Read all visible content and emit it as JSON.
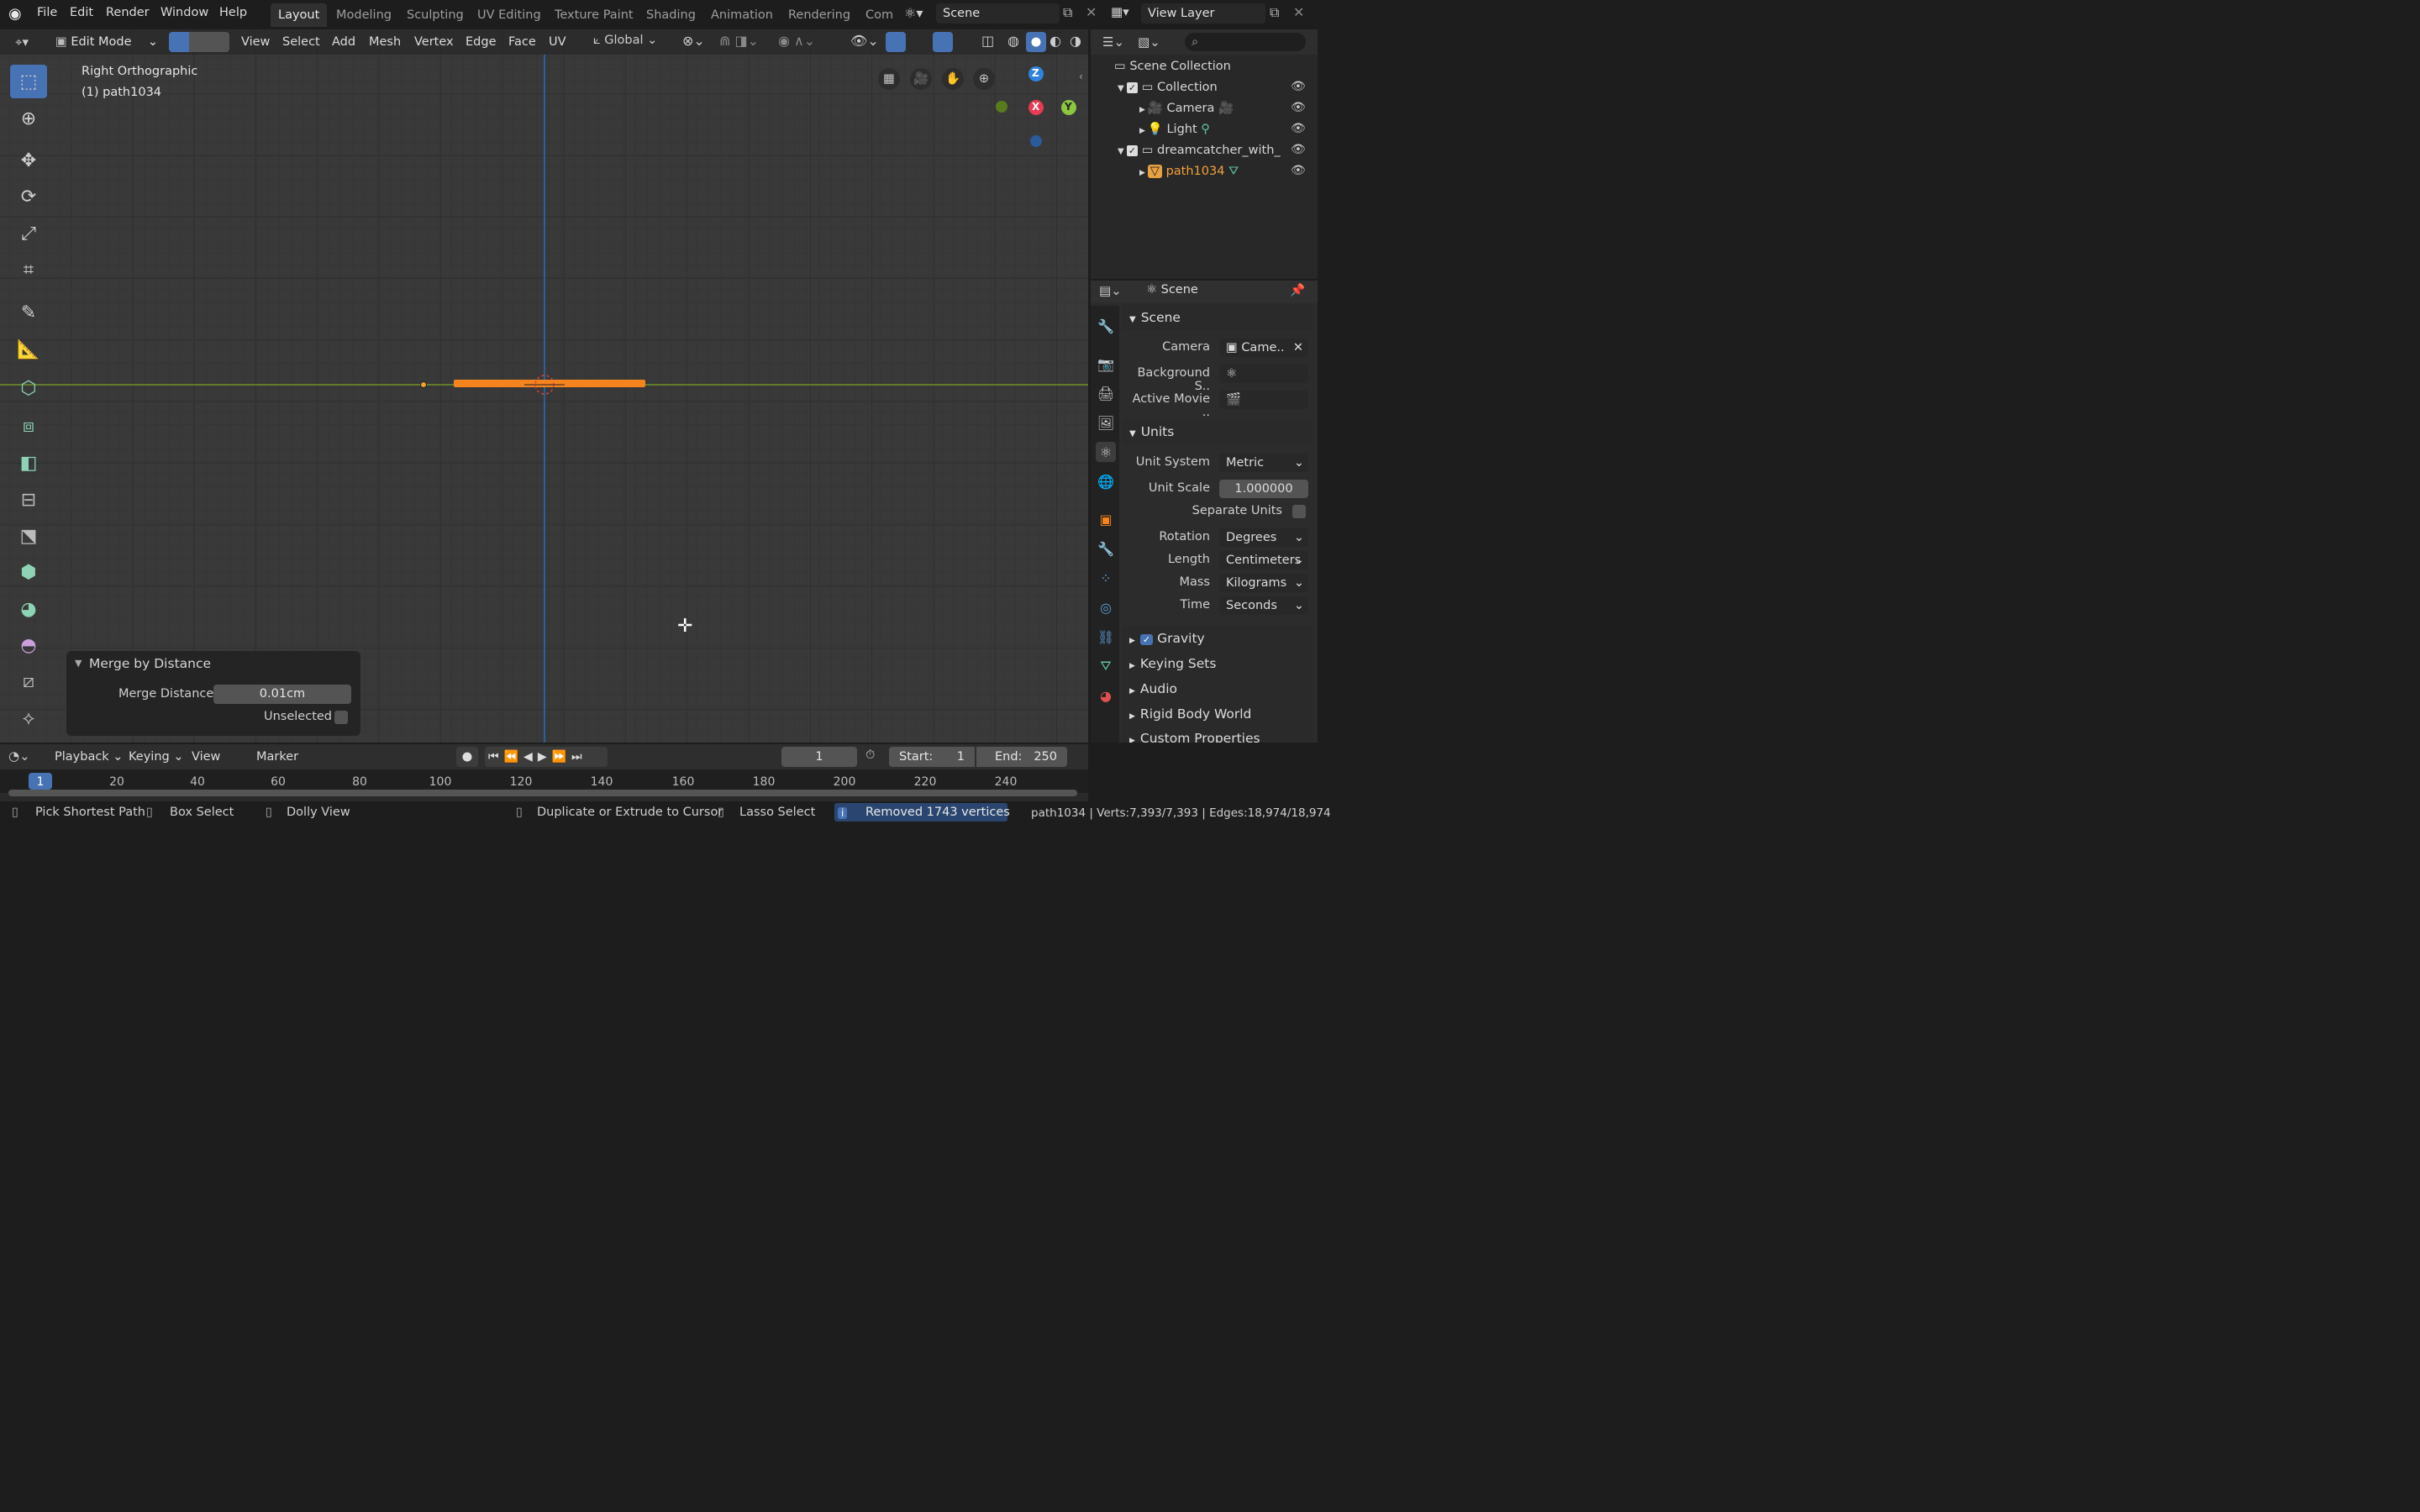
{
  "menubar": {
    "items": [
      "File",
      "Edit",
      "Render",
      "Window",
      "Help"
    ]
  },
  "workspaces": [
    "Layout",
    "Modeling",
    "Sculpting",
    "UV Editing",
    "Texture Paint",
    "Shading",
    "Animation",
    "Rendering",
    "Com"
  ],
  "scene_field": "Scene",
  "view_layer_field": "View Layer",
  "viewport_header": {
    "mode": "Edit Mode",
    "menus": [
      "View",
      "Select",
      "Add",
      "Mesh",
      "Vertex",
      "Edge",
      "Face",
      "UV"
    ],
    "orientation": "Global"
  },
  "overlay_text": {
    "view_name": "Right Orthographic",
    "object_name": "(1) path1034"
  },
  "gizmo": {
    "z": "Z",
    "x": "X",
    "y": "Y"
  },
  "operator_panel": {
    "title": "Merge by Distance",
    "merge_label": "Merge Distance",
    "merge_value": "0.01cm",
    "unselected_label": "Unselected"
  },
  "outliner": {
    "root": "Scene Collection",
    "rows": [
      {
        "label": "Collection"
      },
      {
        "label": "Camera"
      },
      {
        "label": "Light"
      },
      {
        "label": "dreamcatcher_with_"
      },
      {
        "label": "path1034"
      }
    ]
  },
  "properties": {
    "header": "Scene",
    "section_scene": "Scene",
    "camera_label": "Camera",
    "camera_value": "Came..",
    "bg_label": "Background S..",
    "movie_label": "Active Movie ..",
    "section_units": "Units",
    "unit_system_label": "Unit System",
    "unit_system_value": "Metric",
    "unit_scale_label": "Unit Scale",
    "unit_scale_value": "1.000000",
    "separate_units_label": "Separate Units",
    "rotation_label": "Rotation",
    "rotation_value": "Degrees",
    "length_label": "Length",
    "length_value": "Centimeters",
    "mass_label": "Mass",
    "mass_value": "Kilograms",
    "time_label": "Time",
    "time_value": "Seconds",
    "collapsed": [
      "Gravity",
      "Keying Sets",
      "Audio",
      "Rigid Body World",
      "Custom Properties"
    ]
  },
  "timeline": {
    "menus": [
      "Playback",
      "Keying",
      "View",
      "Marker"
    ],
    "current_frame": "1",
    "start_label": "Start:",
    "start": "1",
    "end_label": "End:",
    "end": "250",
    "ruler": [
      "1",
      "20",
      "40",
      "60",
      "80",
      "100",
      "120",
      "140",
      "160",
      "180",
      "200",
      "220",
      "240"
    ]
  },
  "statusbar": {
    "pick": "Pick Shortest Path",
    "box": "Box Select",
    "dolly": "Dolly View",
    "dup": "Duplicate or Extrude to Cursor",
    "lasso": "Lasso Select",
    "report": "Removed 1743 vertices",
    "stats": "path1034 | Verts:7,393/7,393 | Edges:18,974/18,974"
  },
  "colors": {
    "accent": "#4772b3",
    "selected_orange": "#f5841f",
    "object_orange": "#e8a040",
    "x_axis": "#e83a50",
    "y_axis": "#8cc63f",
    "z_axis": "#2f83e0"
  }
}
